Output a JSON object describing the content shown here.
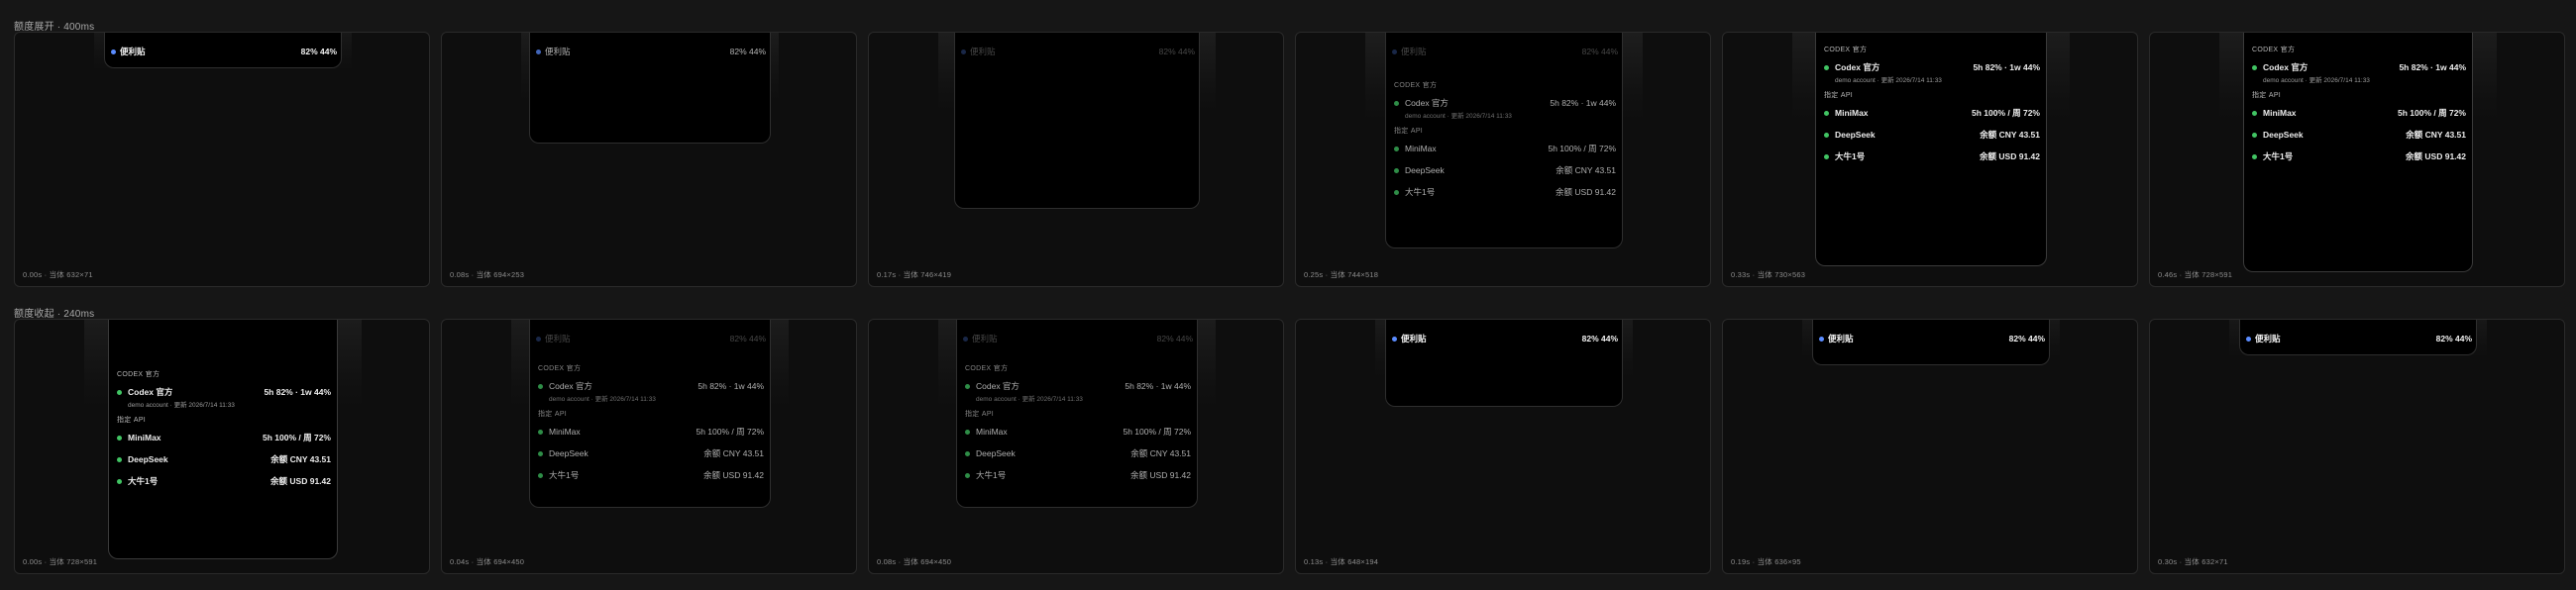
{
  "sections": [
    {
      "title": "额度展开 · 400ms",
      "captions": [
        "0.00s · 当体 632×71",
        "0.08s · 当体 694×253",
        "0.17s · 当体 746×419",
        "0.25s · 当体 744×518",
        "0.33s · 当体 730×563",
        "0.46s · 当体 728×591"
      ]
    },
    {
      "title": "额度收起 · 240ms",
      "captions": [
        "0.00s · 当体 728×591",
        "0.04s · 当体 694×450",
        "0.08s · 当体 694×450",
        "0.13s · 当体 648×194",
        "0.19s · 当体 636×95",
        "0.30s · 当体 632×71"
      ]
    }
  ],
  "pill": {
    "label": "便利贴",
    "value": "82% 44%"
  },
  "panel": {
    "header_codex": "CODEX 官方",
    "codex_name": "Codex 官方",
    "codex_value": "5h 82% · 1w 44%",
    "codex_sub": "demo account · 更新 2026/7/14 11:33",
    "header_api": "指定 API",
    "minimax_name": "MiniMax",
    "minimax_value": "5h 100% / 周 72%",
    "deepseek_name": "DeepSeek",
    "deepseek_value": "余额 CNY 43.51",
    "daniu_name": "大牛1号",
    "daniu_value": "余额 USD 91.42"
  },
  "colors": {
    "background": "#161616",
    "frame": "#0e0e0e",
    "status_green": "#41c463",
    "status_blue": "#5b8cff"
  }
}
